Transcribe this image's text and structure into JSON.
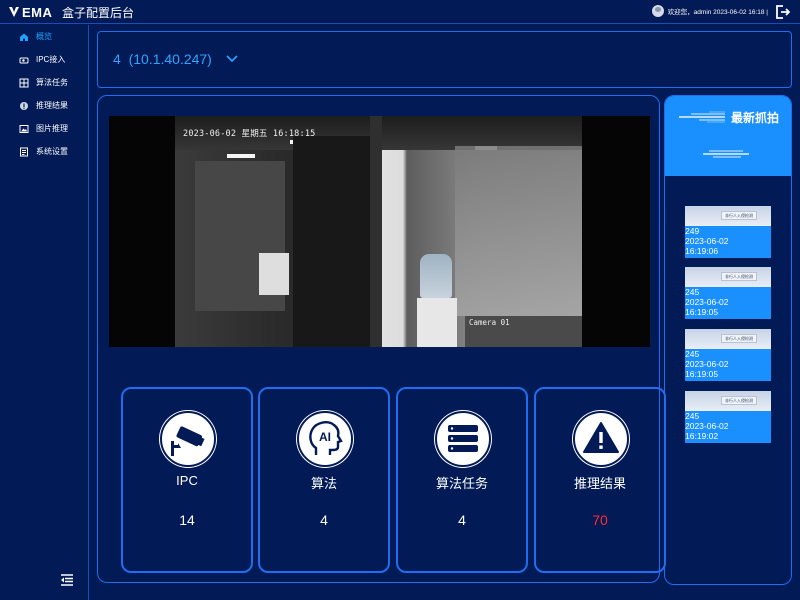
{
  "header": {
    "logo_text": "EMA",
    "app_title": "盒子配置后台",
    "welcome_text": "欢迎您，admin 2023-06-02 16:18 |"
  },
  "sidebar": {
    "items": [
      {
        "label": "概览",
        "icon": "home-icon",
        "active": true
      },
      {
        "label": "IPC接入",
        "icon": "camera-icon",
        "active": false
      },
      {
        "label": "算法任务",
        "icon": "grid-icon",
        "active": false
      },
      {
        "label": "推理结果",
        "icon": "result-icon",
        "active": false
      },
      {
        "label": "图片推理",
        "icon": "image-icon",
        "active": false
      },
      {
        "label": "系统设置",
        "icon": "settings-icon",
        "active": false
      }
    ]
  },
  "camera_selector": {
    "selected": "4  (10.1.40.247)"
  },
  "video": {
    "osd_time": "2023-06-02 星期五 16:18:15",
    "osd_camera": "Camera 01"
  },
  "stats": [
    {
      "label": "IPC",
      "value": "14",
      "icon": "cctv-icon",
      "value_color": "#ffffff"
    },
    {
      "label": "算法",
      "value": "4",
      "icon": "ai-head-icon",
      "value_color": "#ffffff"
    },
    {
      "label": "算法任务",
      "value": "4",
      "icon": "server-stack-icon",
      "value_color": "#ffffff"
    },
    {
      "label": "推理结果",
      "value": "70",
      "icon": "warning-icon",
      "value_color": "#ff2d2d"
    }
  ],
  "latest": {
    "title": "最新抓拍",
    "items": [
      {
        "id": "249",
        "date": "2023-06-02",
        "time": "16:19:06",
        "tag": "非行人入侵检测"
      },
      {
        "id": "245",
        "date": "2023-06-02",
        "time": "16:19:05",
        "tag": "非行人入侵检测"
      },
      {
        "id": "245",
        "date": "2023-06-02",
        "time": "16:19:05",
        "tag": "非行人入侵检测"
      },
      {
        "id": "245",
        "date": "2023-06-02",
        "time": "16:19:02",
        "tag": "非行人入侵检测"
      }
    ]
  },
  "colors": {
    "background": "#021a56",
    "accent": "#1a90ff",
    "border": "#1f6df0",
    "alert": "#ff2d2d"
  }
}
